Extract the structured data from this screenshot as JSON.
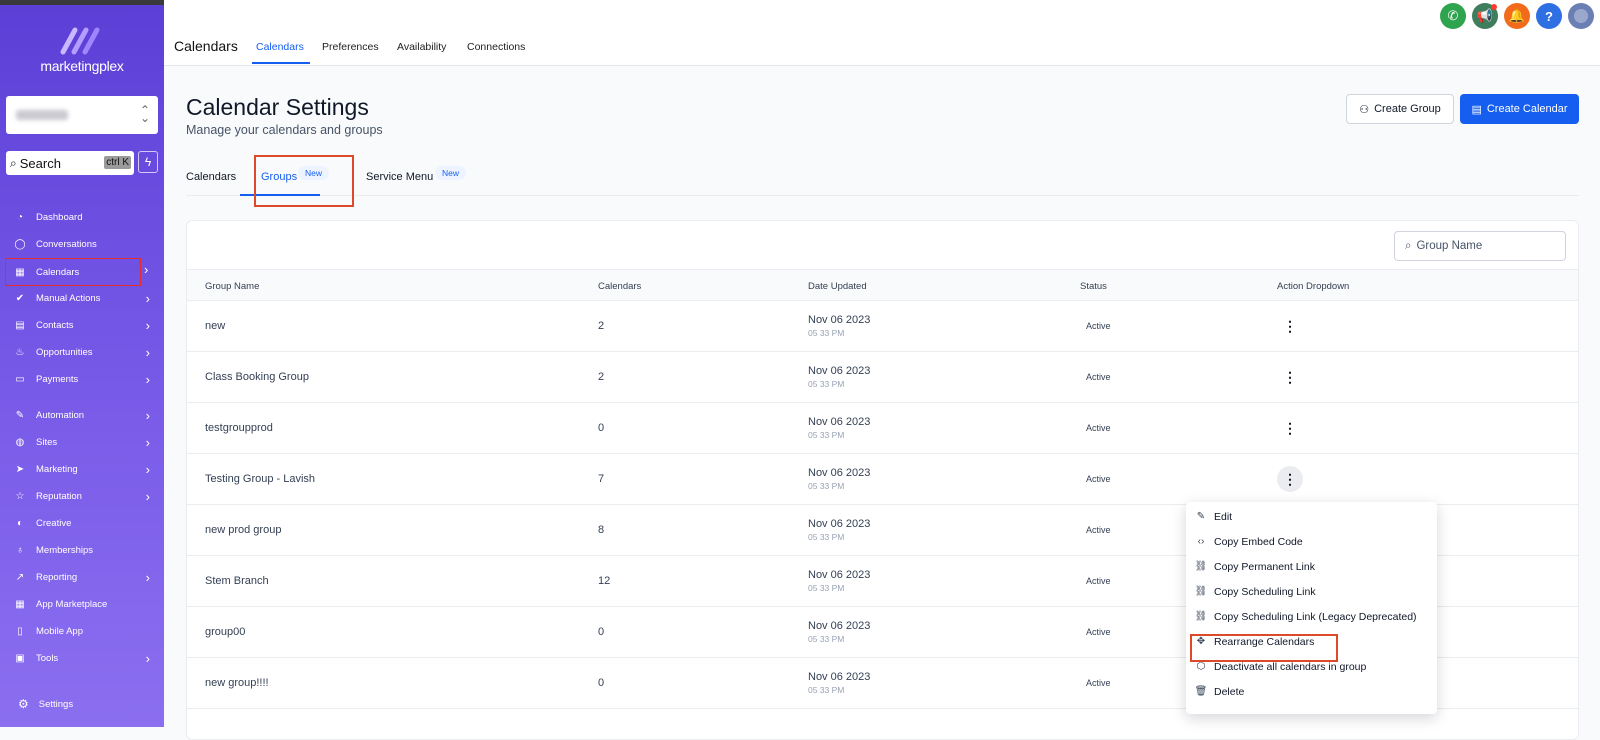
{
  "brand": {
    "name": "marketingplex"
  },
  "search": {
    "label": "Search",
    "shortcut": "ctrl K"
  },
  "sidebar": {
    "items": [
      {
        "label": "Dashboard",
        "icon": "dashboard-icon"
      },
      {
        "label": "Conversations",
        "icon": "chat-icon"
      },
      {
        "label": "Calendars",
        "icon": "calendar-icon"
      },
      {
        "label": "Manual Actions",
        "icon": "check-icon"
      },
      {
        "label": "Contacts",
        "icon": "contacts-icon"
      },
      {
        "label": "Opportunities",
        "icon": "fire-icon"
      },
      {
        "label": "Payments",
        "icon": "card-icon"
      },
      {
        "label": "Automation",
        "icon": "wand-icon"
      },
      {
        "label": "Sites",
        "icon": "globe-icon"
      },
      {
        "label": "Marketing",
        "icon": "send-icon"
      },
      {
        "label": "Reputation",
        "icon": "star-icon"
      },
      {
        "label": "Creative",
        "icon": "palette-icon"
      },
      {
        "label": "Memberships",
        "icon": "award-icon"
      },
      {
        "label": "Reporting",
        "icon": "chart-icon"
      },
      {
        "label": "App Marketplace",
        "icon": "grid-icon"
      },
      {
        "label": "Mobile App",
        "icon": "phone-icon"
      },
      {
        "label": "Tools",
        "icon": "briefcase-icon"
      }
    ],
    "settings": "Settings"
  },
  "topnav": {
    "title": "Calendars",
    "tabs": [
      "Calendars",
      "Preferences",
      "Availability",
      "Connections"
    ]
  },
  "page": {
    "title": "Calendar Settings",
    "subtitle": "Manage your calendars and groups",
    "create_group": "Create Group",
    "create_calendar": "Create Calendar"
  },
  "subtabs": {
    "calendars": "Calendars",
    "groups": "Groups",
    "service_menu": "Service Menu",
    "new_badge": "New"
  },
  "table": {
    "search_placeholder": "Group Name",
    "headers": [
      "Group Name",
      "Calendars",
      "Date Updated",
      "Status",
      "Action Dropdown"
    ],
    "rows": [
      {
        "name": "new",
        "calendars": "2",
        "date": "Nov 06 2023",
        "time": "05 33 PM",
        "status": "Active"
      },
      {
        "name": "Class Booking Group",
        "calendars": "2",
        "date": "Nov 06 2023",
        "time": "05 33 PM",
        "status": "Active"
      },
      {
        "name": "testgroupprod",
        "calendars": "0",
        "date": "Nov 06 2023",
        "time": "05 33 PM",
        "status": "Active"
      },
      {
        "name": "Testing Group - Lavish",
        "calendars": "7",
        "date": "Nov 06 2023",
        "time": "05 33 PM",
        "status": "Active"
      },
      {
        "name": "new prod group",
        "calendars": "8",
        "date": "Nov 06 2023",
        "time": "05 33 PM",
        "status": "Active"
      },
      {
        "name": "Stem Branch",
        "calendars": "12",
        "date": "Nov 06 2023",
        "time": "05 33 PM",
        "status": "Active"
      },
      {
        "name": "group00",
        "calendars": "0",
        "date": "Nov 06 2023",
        "time": "05 33 PM",
        "status": "Active"
      },
      {
        "name": "new group!!!!",
        "calendars": "0",
        "date": "Nov 06 2023",
        "time": "05 33 PM",
        "status": "Active"
      }
    ]
  },
  "menu": {
    "items": [
      {
        "label": "Edit",
        "icon": "pencil-icon"
      },
      {
        "label": "Copy Embed Code",
        "icon": "code-icon"
      },
      {
        "label": "Copy Permanent Link",
        "icon": "link-icon"
      },
      {
        "label": "Copy Scheduling Link",
        "icon": "link-icon"
      },
      {
        "label": "Copy Scheduling Link (Legacy Deprecated)",
        "icon": "link-icon"
      },
      {
        "label": "Rearrange Calendars",
        "icon": "move-icon"
      },
      {
        "label": "Deactivate all calendars in group",
        "icon": "power-icon"
      },
      {
        "label": "Delete",
        "icon": "trash-icon"
      }
    ]
  },
  "colors": {
    "accent": "#155eef",
    "highlight": "#dd4a2a",
    "sidebar_top": "#5b3fd6",
    "sidebar_bottom": "#8b6ff0"
  }
}
